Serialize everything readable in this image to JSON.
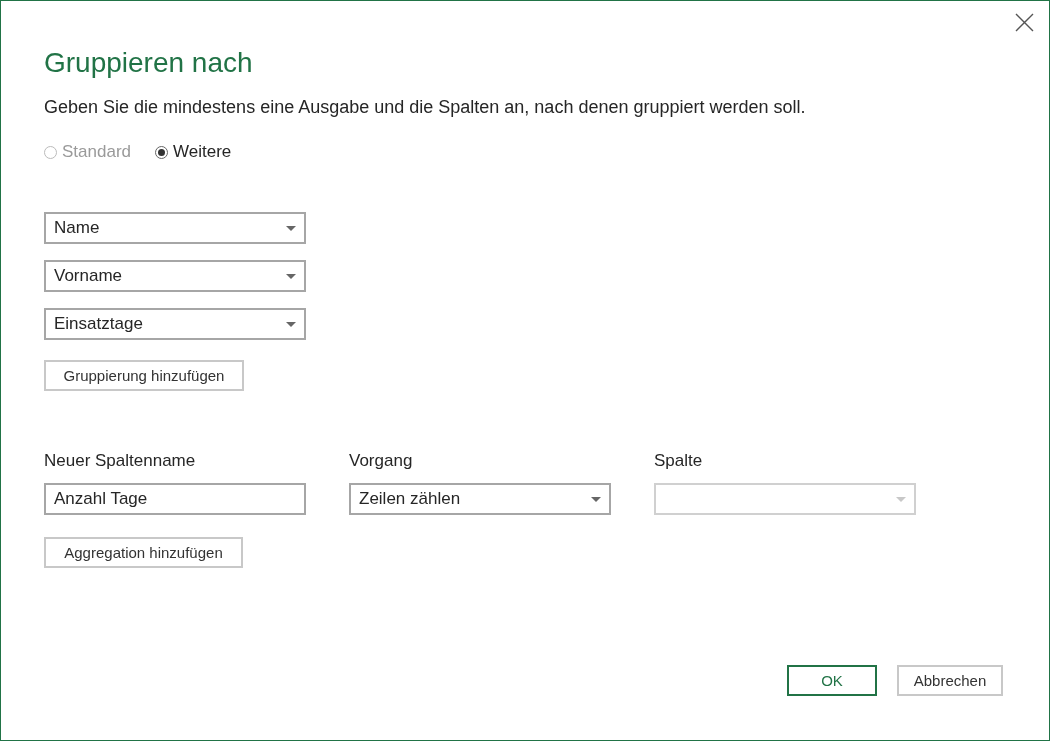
{
  "dialog": {
    "title": "Gruppieren nach",
    "description": "Geben Sie die mindestens eine Ausgabe und die Spalten an, nach denen gruppiert werden soll.",
    "mode_options": [
      {
        "label": "Standard",
        "selected": false,
        "disabled": true
      },
      {
        "label": "Weitere",
        "selected": true,
        "disabled": false
      }
    ],
    "group_by": [
      {
        "value": "Name"
      },
      {
        "value": "Vorname"
      },
      {
        "value": "Einsatztage"
      }
    ],
    "add_grouping_button": "Gruppierung hinzufügen",
    "aggregation_headers": [
      "Neuer Spaltenname",
      "Vorgang",
      "Spalte"
    ],
    "aggregations": [
      {
        "new_column_name": "Anzahl Tage",
        "operation": {
          "value": "Zeilen zählen",
          "disabled": false
        },
        "column": {
          "disabled": true
        }
      }
    ],
    "add_aggregation_button": "Aggregation hinzufügen",
    "buttons": [
      {
        "label": "OK",
        "kind": "primary"
      },
      {
        "label": "Abbrechen",
        "kind": "secondary"
      }
    ]
  }
}
